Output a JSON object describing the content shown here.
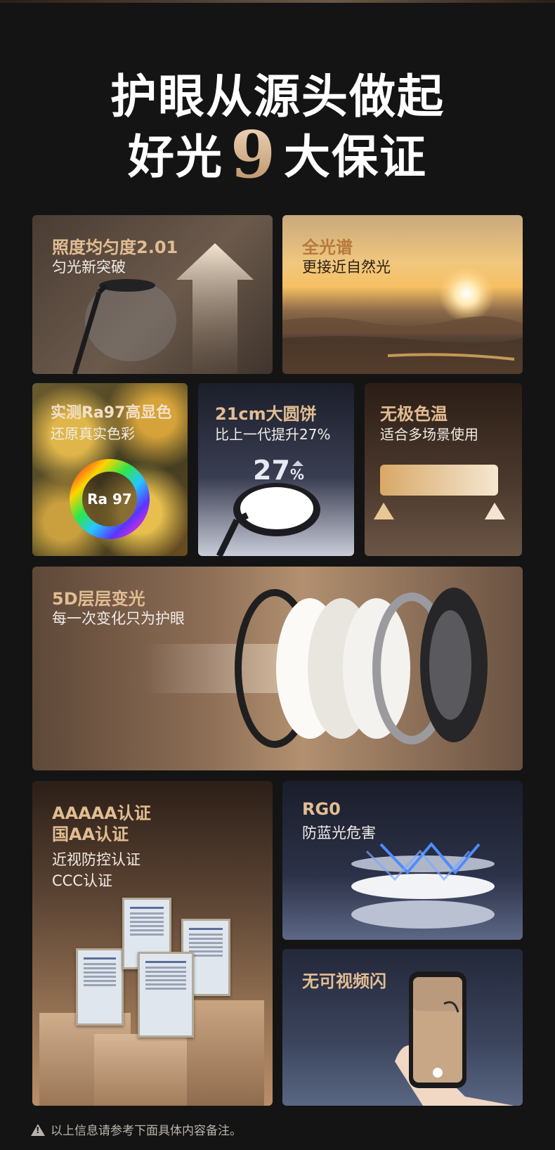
{
  "headline": {
    "line1": "护眼从源头做起",
    "line2_prefix": "好光",
    "line2_number": "9",
    "line2_suffix": "大保证"
  },
  "cards": {
    "uniformity": {
      "title": "照度均匀度2.01",
      "subtitle": "匀光新突破"
    },
    "full_spectrum": {
      "title": "全光谱",
      "subtitle": "更接近自然光"
    },
    "ra97": {
      "title": "实测Ra97高显色",
      "subtitle": "还原真实色彩",
      "badge": "Ra 97"
    },
    "disc": {
      "title": "21cm大圆饼",
      "subtitle": "比上一代提升27%",
      "badge_number": "27",
      "badge_unit": "%"
    },
    "color_temp": {
      "title": "无极色温",
      "subtitle": "适合多场景使用"
    },
    "layers": {
      "title": "5D层层变光",
      "subtitle": "每一次变化只为护眼"
    },
    "certs": {
      "title_line1": "AAAAA认证",
      "title_line2": "国AA认证",
      "subtitle_line1": "近视防控认证",
      "subtitle_line2": "CCC认证"
    },
    "rg0": {
      "title": "RG0",
      "subtitle": "防蓝光危害"
    },
    "flicker": {
      "title": "无可视频闪"
    }
  },
  "footer": {
    "note": "以上信息请参考下面具体内容备注。"
  },
  "colors": {
    "background": "#141414",
    "accent_gold": "#e2bd92",
    "text": "#ffffff"
  },
  "icons": [
    "arrow-up-icon",
    "sun-icon",
    "color-wheel-icon",
    "up-arrow-small-icon",
    "triangle-icon",
    "warning-icon",
    "blue-light-arrow-icon"
  ]
}
